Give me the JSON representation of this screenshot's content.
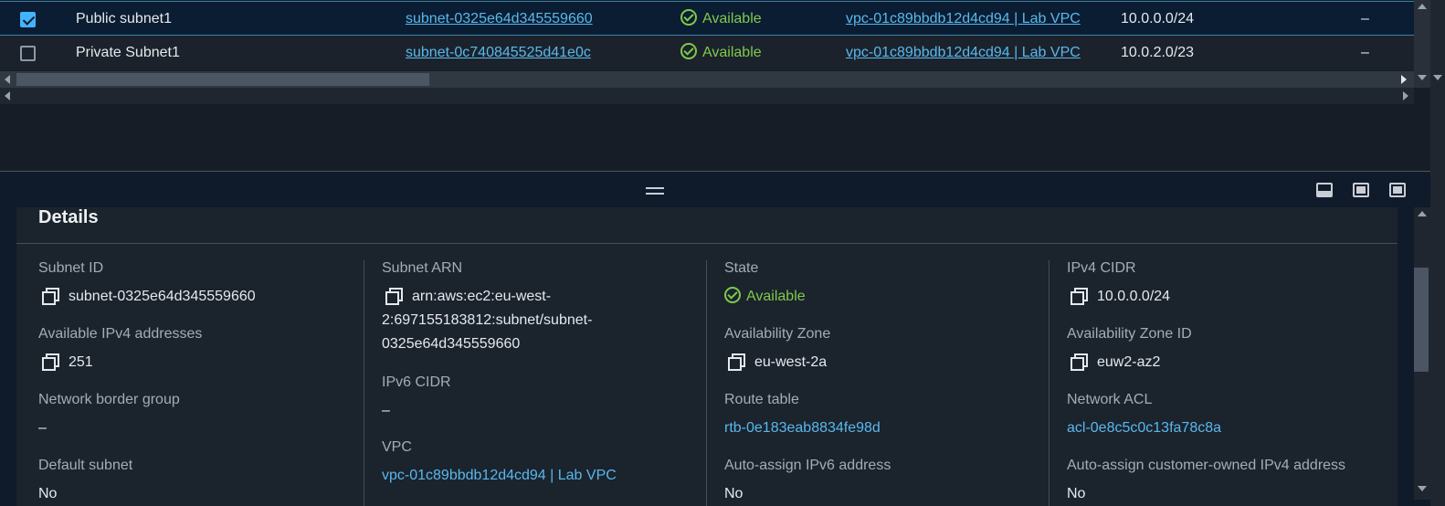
{
  "table": {
    "rows": [
      {
        "selected": true,
        "name": "Public subnet1",
        "subnet_id": "subnet-0325e64d345559660",
        "state": "Available",
        "vpc": "vpc-01c89bbdb12d4cd94 | Lab VPC",
        "ipv4_cidr": "10.0.0.0/24",
        "ipv6_cidr": "–"
      },
      {
        "selected": false,
        "name": "Private Subnet1",
        "subnet_id": "subnet-0c740845525d41e0c",
        "state": "Available",
        "vpc": "vpc-01c89bbdb12d4cd94 | Lab VPC",
        "ipv4_cidr": "10.0.2.0/23",
        "ipv6_cidr": "–"
      }
    ]
  },
  "details": {
    "title": "Details",
    "subnet_id": {
      "label": "Subnet ID",
      "value": "subnet-0325e64d345559660"
    },
    "available_ipv4": {
      "label": "Available IPv4 addresses",
      "value": "251"
    },
    "network_border_group": {
      "label": "Network border group",
      "value": "–"
    },
    "default_subnet": {
      "label": "Default subnet",
      "value": "No"
    },
    "subnet_arn": {
      "label": "Subnet ARN",
      "line1": "arn:aws:ec2:eu-west-",
      "line2": "2:697155183812:subnet/subnet-",
      "line3": "0325e64d345559660"
    },
    "ipv6_cidr": {
      "label": "IPv6 CIDR",
      "value": "–"
    },
    "vpc": {
      "label": "VPC",
      "value": "vpc-01c89bbdb12d4cd94 | Lab VPC"
    },
    "state": {
      "label": "State",
      "value": "Available"
    },
    "availability_zone": {
      "label": "Availability Zone",
      "value": "eu-west-2a"
    },
    "route_table": {
      "label": "Route table",
      "value": "rtb-0e183eab8834fe98d"
    },
    "auto_assign_ipv6": {
      "label": "Auto-assign IPv6 address",
      "value": "No"
    },
    "ipv4_cidr": {
      "label": "IPv4 CIDR",
      "value": "10.0.0.0/24"
    },
    "availability_zone_id": {
      "label": "Availability Zone ID",
      "value": "euw2-az2"
    },
    "network_acl": {
      "label": "Network ACL",
      "value": "acl-0e8c5c0c13fa78c8a"
    },
    "auto_assign_customer_ipv4": {
      "label": "Auto-assign customer-owned IPv4 address",
      "value": "No"
    }
  },
  "colors": {
    "link": "#59b8ec",
    "available": "#7fc94a",
    "selection_border": "#3b82a6",
    "checkbox": "#42b4ff"
  },
  "icons": [
    "check-icon",
    "status-available-icon",
    "copy-icon",
    "drag-handle-icon",
    "panel-bottom-icon",
    "panel-side-icon",
    "panel-full-icon"
  ]
}
